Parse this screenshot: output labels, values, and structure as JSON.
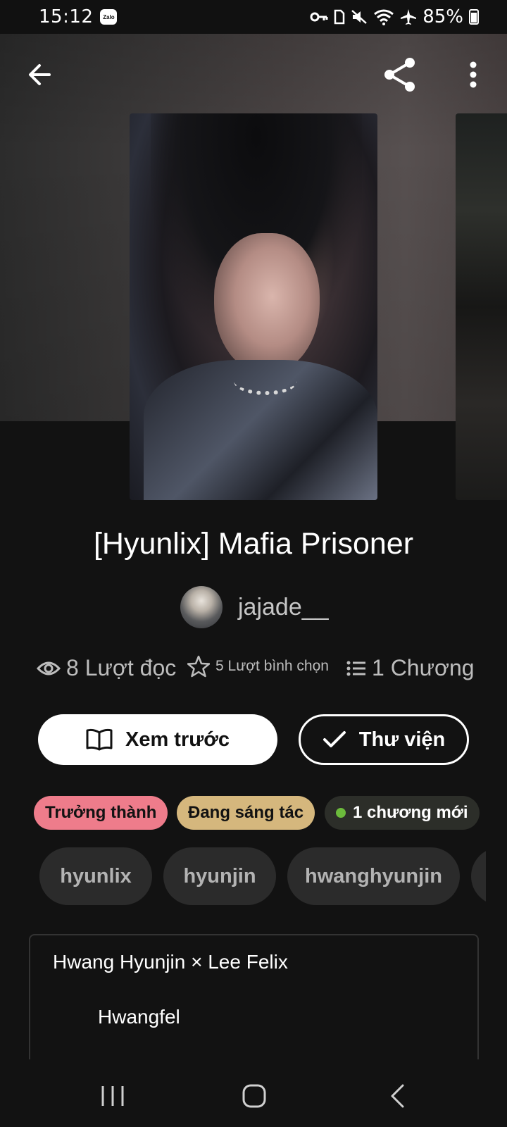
{
  "status_bar": {
    "time": "15:12",
    "app_badge": "Zalo",
    "battery": "85%",
    "icons": [
      "vpn-key-icon",
      "sim-icon",
      "mute-icon",
      "wifi-icon",
      "airplane-icon",
      "battery-icon"
    ]
  },
  "header": {
    "back_icon": "arrow-left-icon",
    "share_icon": "share-icon",
    "more_icon": "more-vertical-icon"
  },
  "story": {
    "title": "[Hyunlix] Mafia Prisoner",
    "author": "jajade__",
    "stats": {
      "reads": "8 Lượt đọc",
      "votes": "5 Lượt bình chọn",
      "parts": "1 Chương"
    }
  },
  "actions": {
    "preview_label": "Xem trước",
    "library_label": "Thư viện"
  },
  "badges": {
    "mature": "Trưởng thành",
    "ongoing": "Đang sáng tác",
    "new_chapter": "1 chương mới"
  },
  "tags": [
    "hyunlix",
    "hyunjin",
    "hwanghyunjin"
  ],
  "description": {
    "line1": "Hwang Hyunjin × Lee Felix",
    "line2": "Hwangfel"
  },
  "colors": {
    "background": "#121212",
    "mature": "#ee7c8b",
    "ongoing": "#d5b77d",
    "new_dot": "#6cbb3c"
  }
}
